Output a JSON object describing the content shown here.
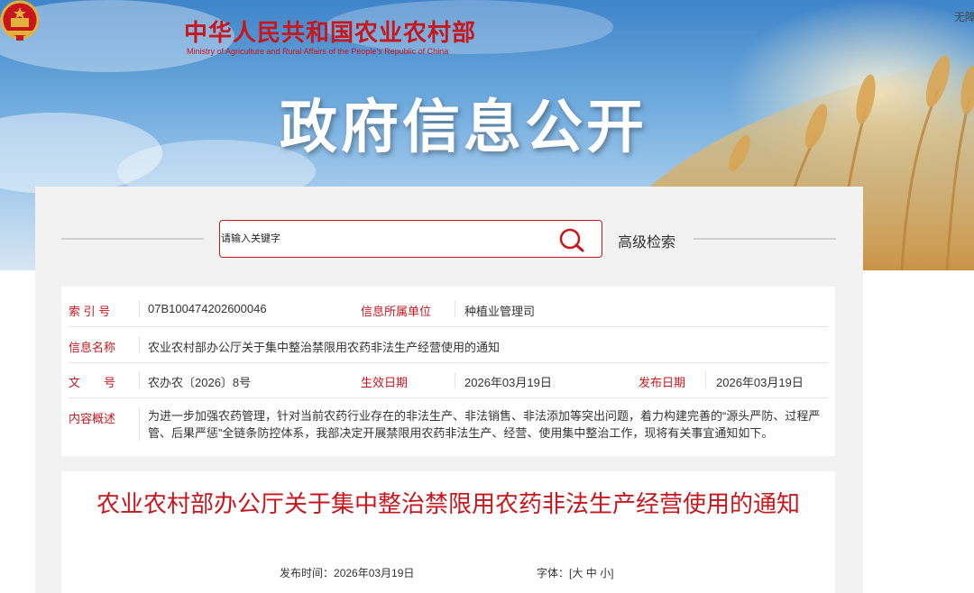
{
  "header": {
    "ministry_cn": "中华人民共和国农业农村部",
    "ministry_en": "Ministry of Agriculture and Rural Affairs of the People's Republic of China",
    "section_title": "政府信息公开",
    "accessibility_link": "无障"
  },
  "search": {
    "placeholder": "请输入关键字",
    "advanced_label": "高级检索",
    "icon": "search-icon"
  },
  "meta": {
    "index_label": "索 引 号",
    "index_value": "07B100474202600046",
    "unit_label": "信息所属单位",
    "unit_value": "种植业管理司",
    "name_label": "信息名称",
    "name_value": "农业农村部办公厅关于集中整治禁限用农药非法生产经营使用的通知",
    "docno_label": "文　　号",
    "docno_value": "农办农〔2026〕8号",
    "effective_label": "生效日期",
    "effective_value": "2026年03月19日",
    "publish_label": "发布日期",
    "publish_value": "2026年03月19日",
    "summary_label": "内容概述",
    "summary_value": "为进一步加强农药管理，针对当前农药行业存在的非法生产、非法销售、非法添加等突出问题，着力构建完善的“源头严防、过程严管、后果严惩”全链条防控体系，我部决定开展禁限用农药非法生产、经营、使用集中整治工作，现将有关事宜通知如下。"
  },
  "document": {
    "title": "农业农村部办公厅关于集中整治禁限用农药非法生产经营使用的通知",
    "publish_time_label": "发布时间：",
    "publish_time": "2026年03月19日",
    "font_label": "字体：",
    "font_open": "[",
    "font_large": "大",
    "font_medium": "中",
    "font_small": "小",
    "font_close": "]"
  },
  "colors": {
    "accent": "#c8161d",
    "panel": "#f2f2f2"
  }
}
